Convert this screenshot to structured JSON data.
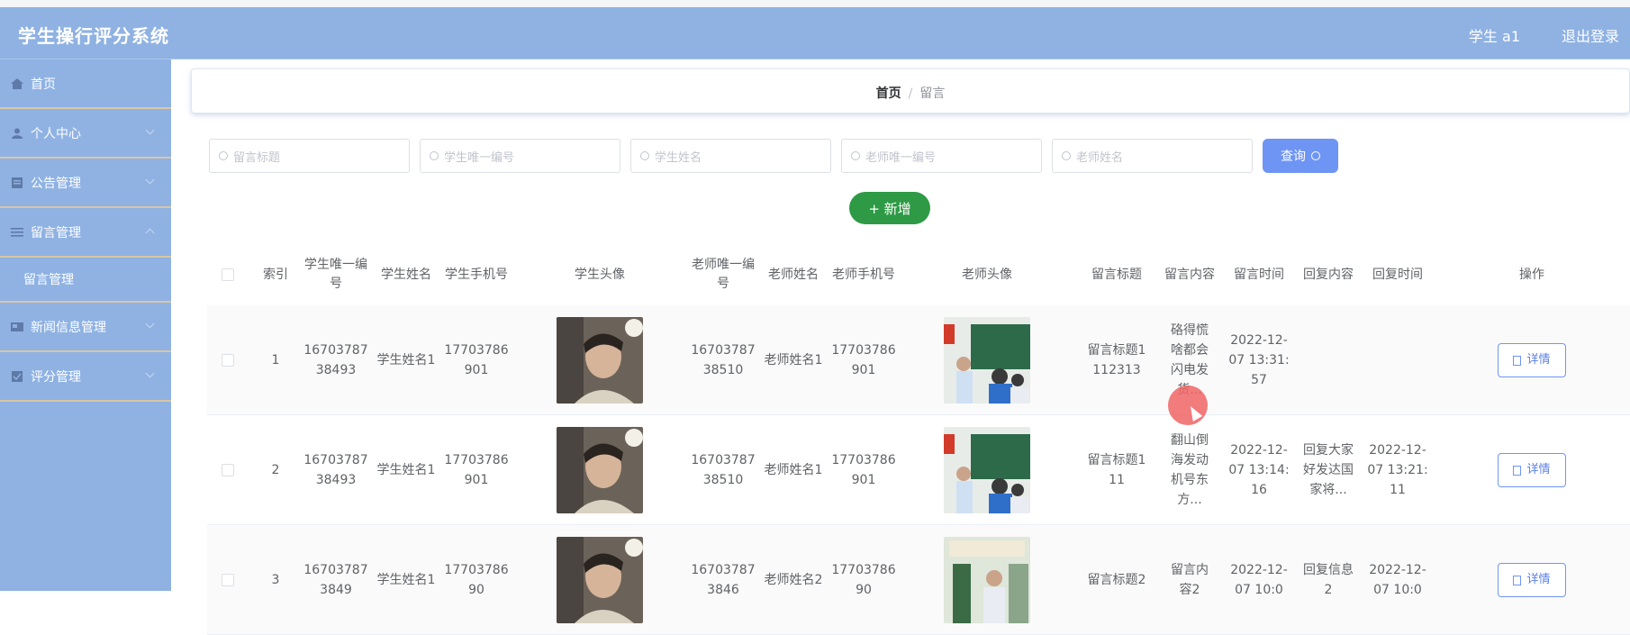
{
  "app": {
    "title": "学生操行评分系统",
    "user": "学生 a1",
    "logout": "退出登录"
  },
  "sidebar": {
    "items": [
      {
        "label": "首页",
        "icon": "home-icon"
      },
      {
        "label": "个人中心",
        "icon": "user-icon"
      },
      {
        "label": "公告管理",
        "icon": "notice-icon"
      },
      {
        "label": "留言管理",
        "icon": "message-icon"
      },
      {
        "label": "留言管理",
        "icon": ""
      },
      {
        "label": "新闻信息管理",
        "icon": "news-icon"
      },
      {
        "label": "评分管理",
        "icon": "score-icon"
      }
    ]
  },
  "breadcrumb": {
    "home": "首页",
    "sep": "/",
    "current": "留言"
  },
  "search": {
    "title_placeholder": "留言标题",
    "student_no_placeholder": "学生唯一编号",
    "student_name_placeholder": "学生姓名",
    "teacher_no_placeholder": "老师唯一编号",
    "teacher_name_placeholder": "老师姓名",
    "query_label": "查询"
  },
  "actions": {
    "add_label": "+ 新增"
  },
  "table": {
    "headers": [
      "索引",
      "学生唯一编号",
      "学生姓名",
      "学生手机号",
      "学生头像",
      "老师唯一编号",
      "老师姓名",
      "老师手机号",
      "老师头像",
      "留言标题",
      "留言内容",
      "留言时间",
      "回复内容",
      "回复时间",
      "操作"
    ],
    "rows": [
      {
        "index": "1",
        "student_no": "1670378738493",
        "student_name": "学生姓名1",
        "student_phone": "17703786901",
        "teacher_no": "1670378738510",
        "teacher_name": "老师姓名1",
        "teacher_phone": "17703786901",
        "title": "留言标题1112313",
        "content": "硌得慌啥都会闪电发货...",
        "time": "2022-12-07 13:31:57",
        "reply": "",
        "reply_time": "",
        "detail": "详情"
      },
      {
        "index": "2",
        "student_no": "1670378738493",
        "student_name": "学生姓名1",
        "student_phone": "17703786901",
        "teacher_no": "1670378738510",
        "teacher_name": "老师姓名1",
        "teacher_phone": "17703786901",
        "title": "留言标题111",
        "content": "翻山倒海发动机号东方...",
        "time": "2022-12-07 13:14:16",
        "reply": "回复大家好发达国家将...",
        "reply_time": "2022-12-07 13:21:11",
        "detail": "详情"
      },
      {
        "index": "3",
        "student_no": "167037873849",
        "student_name": "学生姓名1",
        "student_phone": "1770378690",
        "teacher_no": "167037873846",
        "teacher_name": "老师姓名2",
        "teacher_phone": "1770378690",
        "title": "留言标题2",
        "content": "留言内容2",
        "time": "2022-12-07 10:0",
        "reply": "回复信息2",
        "reply_time": "2022-12-07 10:0",
        "detail": "详情"
      }
    ]
  }
}
